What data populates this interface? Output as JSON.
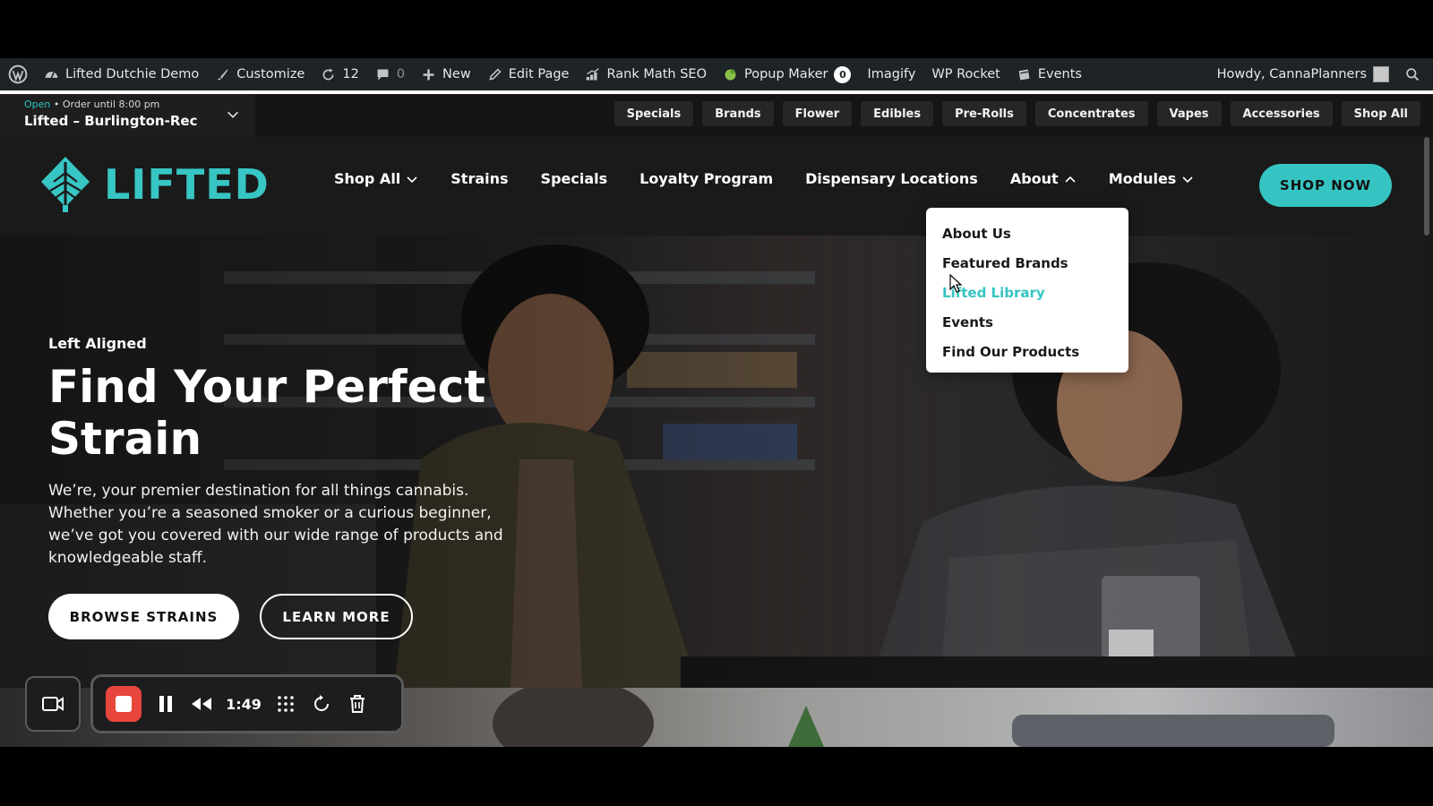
{
  "adminbar": {
    "site_name": "Lifted Dutchie Demo",
    "customize": "Customize",
    "updates": "12",
    "comments": "0",
    "new": "New",
    "edit_page": "Edit Page",
    "rank_math": "Rank Math SEO",
    "popup_maker": "Popup Maker",
    "popup_count": "0",
    "imagify": "Imagify",
    "wp_rocket": "WP Rocket",
    "events": "Events",
    "howdy": "Howdy, CannaPlanners"
  },
  "store": {
    "status_open": "Open",
    "status_rest": "• Order until 8:00 pm",
    "name": "Lifted – Burlington-Rec"
  },
  "categories": [
    "Specials",
    "Brands",
    "Flower",
    "Edibles",
    "Pre-Rolls",
    "Concentrates",
    "Vapes",
    "Accessories",
    "Shop All"
  ],
  "header": {
    "logo_text": "LIFTED",
    "nav": {
      "shop_all": "Shop All",
      "strains": "Strains",
      "specials": "Specials",
      "loyalty": "Loyalty Program",
      "locations": "Dispensary Locations",
      "about": "About",
      "modules": "Modules"
    },
    "shop_now": "SHOP NOW"
  },
  "about_menu": [
    "About Us",
    "Featured Brands",
    "Lifted Library",
    "Events",
    "Find Our Products"
  ],
  "hero": {
    "eyebrow": "Left Aligned",
    "headline": "Find Your Perfect Strain",
    "lead": "We’re, your premier destination for all things cannabis. Whether you’re a seasoned smoker or a curious beginner, we’ve got you covered with our wide range of products and knowledgeable staff.",
    "browse": "BROWSE STRAINS",
    "learn": "LEARN MORE"
  },
  "recorder": {
    "time": "1:49"
  },
  "colors": {
    "accent": "#35c4c2",
    "adminbar": "#1d2327",
    "record": "#e8453c"
  }
}
